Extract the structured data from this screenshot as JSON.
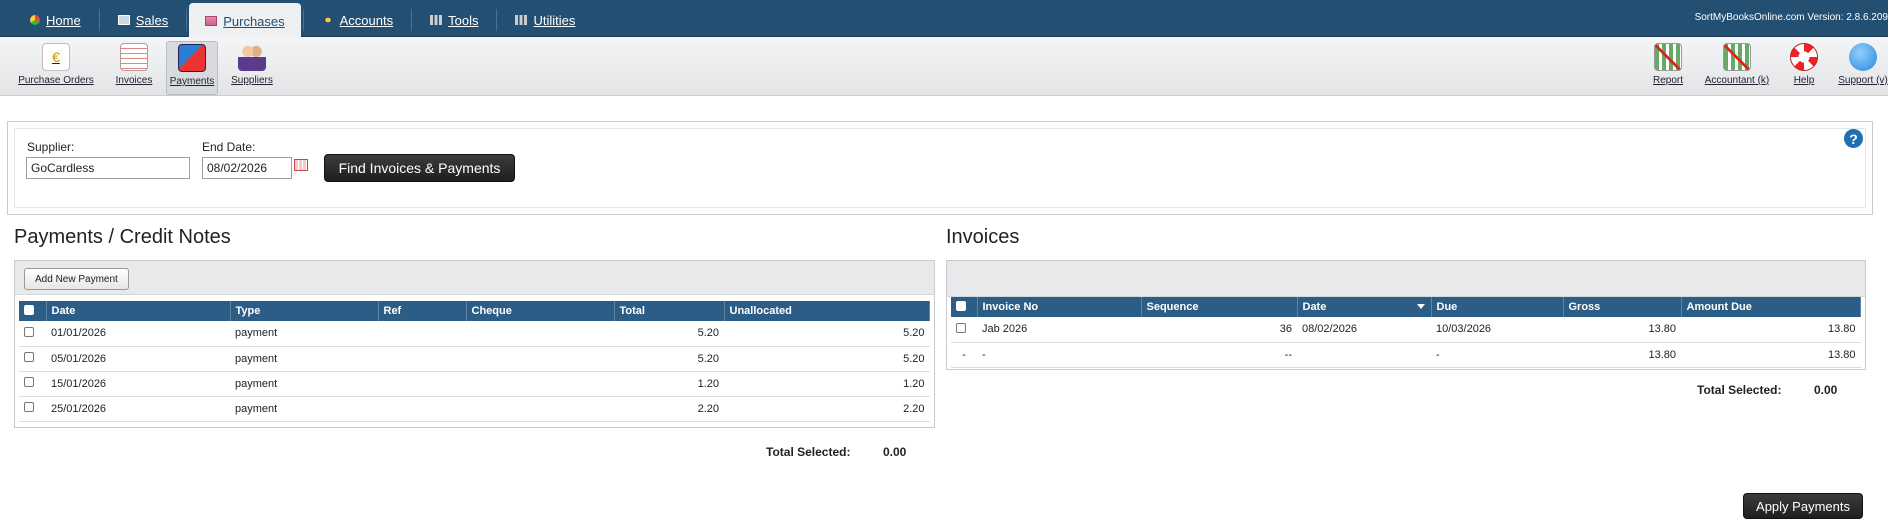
{
  "nav": {
    "tabs": [
      {
        "label": "Home",
        "icon": "home-icon"
      },
      {
        "label": "Sales",
        "icon": "sales-icon"
      },
      {
        "label": "Purchases",
        "icon": "purchases-icon"
      },
      {
        "label": "Accounts",
        "icon": "accounts-icon"
      },
      {
        "label": "Tools",
        "icon": "tools-icon"
      },
      {
        "label": "Utilities",
        "icon": "utilities-icon"
      }
    ],
    "active_tab": "Purchases",
    "version": "SortMyBooksOnline.com Version: 2.8.6.209"
  },
  "toolbar": {
    "left": [
      {
        "label": "Purchase Orders",
        "icon": "purchase-orders-icon"
      },
      {
        "label": "Invoices",
        "icon": "invoices-icon"
      },
      {
        "label": "Payments",
        "icon": "payments-icon"
      },
      {
        "label": "Suppliers",
        "icon": "suppliers-icon"
      }
    ],
    "active": "Payments",
    "right": [
      {
        "label": "Report",
        "icon": "report-icon"
      },
      {
        "label": "Accountant (k)",
        "icon": "accountant-icon"
      },
      {
        "label": "Help",
        "icon": "lifebuoy-icon"
      },
      {
        "label": "Support (v)",
        "icon": "support-chat-icon"
      }
    ]
  },
  "filter": {
    "supplier_label": "Supplier:",
    "supplier_value": "GoCardless",
    "end_date_label": "End Date:",
    "end_date_value": "08/02/2026",
    "find_button": "Find Invoices & Payments",
    "help": "?"
  },
  "payments": {
    "title": "Payments / Credit Notes",
    "add_button": "Add New Payment",
    "columns": [
      "Date",
      "Type",
      "Ref",
      "Cheque",
      "Total",
      "Unallocated"
    ],
    "rows": [
      {
        "date": "01/01/2026",
        "type": "payment",
        "ref": "",
        "cheque": "",
        "total": "5.20",
        "unallocated": "5.20"
      },
      {
        "date": "05/01/2026",
        "type": "payment",
        "ref": "",
        "cheque": "",
        "total": "5.20",
        "unallocated": "5.20"
      },
      {
        "date": "15/01/2026",
        "type": "payment",
        "ref": "",
        "cheque": "",
        "total": "1.20",
        "unallocated": "1.20"
      },
      {
        "date": "25/01/2026",
        "type": "payment",
        "ref": "",
        "cheque": "",
        "total": "2.20",
        "unallocated": "2.20"
      }
    ],
    "total_selected_label": "Total Selected:",
    "total_selected_value": "0.00"
  },
  "invoices": {
    "title": "Invoices",
    "columns": [
      "Invoice No",
      "Sequence",
      "Date",
      "Due",
      "Gross",
      "Amount Due"
    ],
    "rows": [
      {
        "check": true,
        "invoice_no": "Jab 2026",
        "sequence": "36",
        "date": "08/02/2026",
        "due": "10/03/2026",
        "gross": "13.80",
        "amount_due": "13.80"
      },
      {
        "check": false,
        "lead": "-",
        "invoice_no": "-",
        "sequence": "--",
        "date": "",
        "due": "-",
        "gross": "13.80",
        "amount_due": "13.80"
      }
    ],
    "total_selected_label": "Total Selected:",
    "total_selected_value": "0.00"
  },
  "apply_button": "Apply Payments",
  "colors": {
    "nav": "#234f73",
    "header_row": "#2b5d86",
    "dark_button": "#2a2a2a"
  }
}
